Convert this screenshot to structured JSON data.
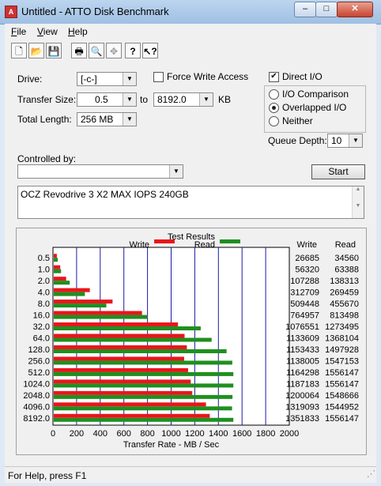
{
  "window": {
    "title": "Untitled - ATTO Disk Benchmark",
    "app_icon": "atto-app-icon",
    "controls": {
      "minimize": "–",
      "maximize": "□",
      "close": "✕"
    }
  },
  "menu": [
    {
      "label": "File",
      "u": "F",
      "rest": "ile"
    },
    {
      "label": "View",
      "u": "V",
      "rest": "iew"
    },
    {
      "label": "Help",
      "u": "H",
      "rest": "elp"
    }
  ],
  "toolbar": [
    "new-document-icon",
    "open-folder-icon",
    "save-icon",
    "print-icon",
    "print-preview-icon",
    "move-icon",
    "help-icon",
    "context-help-icon"
  ],
  "form": {
    "drive_label": "Drive:",
    "drive_value": "[-c-]",
    "force_write_label": "Force Write Access",
    "force_write_checked": false,
    "direct_io_label": "Direct I/O",
    "direct_io_checked": true,
    "transfer_size_label": "Transfer Size:",
    "transfer_from": "0.5",
    "to_label": "to",
    "transfer_to": "8192.0",
    "kb_label": "KB",
    "total_length_label": "Total Length:",
    "total_length": "256 MB",
    "io_options": [
      {
        "label": "I/O Comparison",
        "selected": false
      },
      {
        "label": "Overlapped I/O",
        "selected": true
      },
      {
        "label": "Neither",
        "selected": false
      }
    ],
    "queue_depth_label": "Queue Depth:",
    "queue_depth": "10",
    "controlled_by_label": "Controlled by:",
    "controlled_by_value": "",
    "start_label": "Start",
    "description": "OCZ Revodrive 3 X2 MAX IOPS 240GB"
  },
  "chart_data": {
    "type": "bar",
    "title": "Test Results",
    "xlabel": "Transfer Rate - MB / Sec",
    "xlim": [
      0,
      2000
    ],
    "xticks": [
      0,
      200,
      400,
      600,
      800,
      1000,
      1200,
      1400,
      1600,
      1800,
      2000
    ],
    "grid": true,
    "legend_position": "top",
    "categories": [
      "0.5",
      "1.0",
      "2.0",
      "4.0",
      "8.0",
      "16.0",
      "32.0",
      "64.0",
      "128.0",
      "256.0",
      "512.0",
      "1024.0",
      "2048.0",
      "4096.0",
      "8192.0"
    ],
    "series": [
      {
        "name": "Write",
        "color": "#e8161b",
        "values": [
          26.1,
          55.0,
          104.8,
          305.4,
          497.6,
          746.9,
          1051.3,
          1107.0,
          1126.4,
          1103.5,
          1137.0,
          1159.4,
          1171.9,
          1288.2,
          1320.2
        ]
      },
      {
        "name": "Read",
        "color": "#1f8f1f",
        "values": [
          33.7,
          61.9,
          135.1,
          263.2,
          445.0,
          794.4,
          1243.6,
          1336.1,
          1462.4,
          1511.0,
          1519.7,
          1519.7,
          1512.4,
          1508.8,
          1519.7
        ]
      }
    ],
    "table_headers": [
      "Write",
      "Read"
    ],
    "table": [
      [
        "26685",
        "34560"
      ],
      [
        "56320",
        "63388"
      ],
      [
        "107288",
        "138313"
      ],
      [
        "312709",
        "269459"
      ],
      [
        "509448",
        "455670"
      ],
      [
        "764957",
        "813498"
      ],
      [
        "1076551",
        "1273495"
      ],
      [
        "1133609",
        "1368104"
      ],
      [
        "1153433",
        "1497928"
      ],
      [
        "1138005",
        "1547153"
      ],
      [
        "1164298",
        "1556147"
      ],
      [
        "1187183",
        "1556147"
      ],
      [
        "1200064",
        "1548666"
      ],
      [
        "1319093",
        "1544952"
      ],
      [
        "1351833",
        "1556147"
      ]
    ]
  },
  "status": "For Help, press F1"
}
